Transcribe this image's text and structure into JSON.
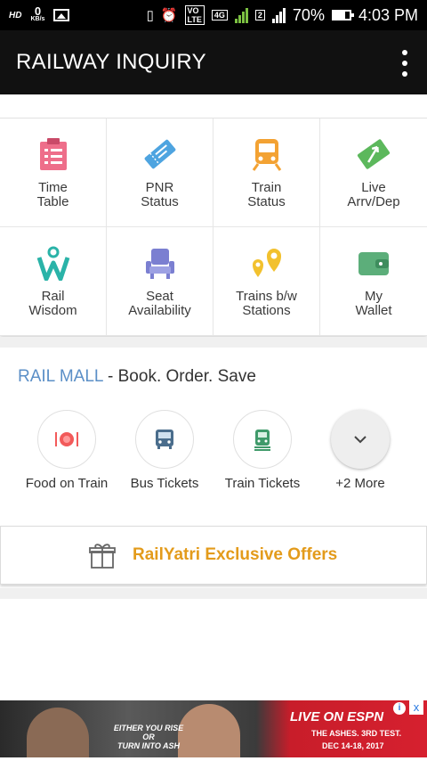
{
  "status_bar": {
    "hd": "HD",
    "speed_value": "0",
    "speed_unit": "KB/s",
    "vo_label": "VO",
    "lte_label": "LTE",
    "network_label": "4G",
    "sim2_label": "2",
    "battery": "70%",
    "time": "4:03 PM"
  },
  "app_bar": {
    "title": "RAILWAY INQUIRY",
    "menu_icon": "overflow-menu-icon"
  },
  "grid": {
    "tiles": [
      {
        "line1": "Time",
        "line2": "Table",
        "icon": "clipboard-icon",
        "color": "#ee6e8a"
      },
      {
        "line1": "PNR",
        "line2": "Status",
        "icon": "ticket-icon",
        "color": "#4ea4e0"
      },
      {
        "line1": "Train",
        "line2": "Status",
        "icon": "train-icon",
        "color": "#f3a233"
      },
      {
        "line1": "Live",
        "line2": "Arrv/Dep",
        "icon": "arrows-icon",
        "color": "#5cb85c"
      },
      {
        "line1": "Rail",
        "line2": "Wisdom",
        "icon": "wisdom-icon",
        "color": "#2ab3a8"
      },
      {
        "line1": "Seat",
        "line2": "Availability",
        "icon": "seat-icon",
        "color": "#7b7fd1"
      },
      {
        "line1": "Trains b/w",
        "line2": "Stations",
        "icon": "location-pins-icon",
        "color": "#f2c12e"
      },
      {
        "line1": "My",
        "line2": "Wallet",
        "icon": "wallet-icon",
        "color": "#5cae7a"
      }
    ]
  },
  "rail_mall": {
    "brand": "RAIL MALL",
    "tagline": " - Book. Order. Save",
    "items": [
      {
        "label": "Food on Train",
        "icon": "food-plate-icon"
      },
      {
        "label": "Bus Tickets",
        "icon": "bus-icon"
      },
      {
        "label": "Train Tickets",
        "icon": "train-ticket-icon"
      },
      {
        "label": "+2 More",
        "icon": "chevron-down-icon"
      }
    ]
  },
  "offers": {
    "label": "RailYatri Exclusive Offers",
    "icon": "gift-icon",
    "color": "#e39b1b"
  },
  "ad": {
    "middle_line1": "EITHER YOU RISE",
    "middle_line2": "OR",
    "middle_line3": "TURN INTO ASH",
    "live_on": "LIVE ON ESPN",
    "sub_line1": "THE ASHES. 3RD TEST.",
    "sub_line2": "DEC 14-18, 2017",
    "info_glyph": "i",
    "close_glyph": "x"
  }
}
